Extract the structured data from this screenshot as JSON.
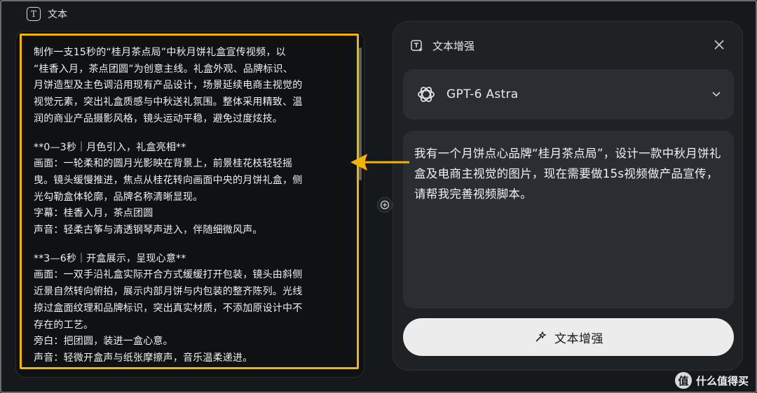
{
  "topbar": {
    "title": "文本",
    "icon": "text-icon"
  },
  "left_panel": {
    "script": {
      "intro": [
        "制作一支15秒的“桂月茶点局”中秋月饼礼盒宣传视频，以",
        "“桂香入月，茶点团圆”为创意主线。礼盒外观、品牌标识、",
        "月饼造型及主色调沿用现有产品设计，场景延续电商主视觉的",
        "视觉元素，突出礼盒质感与中秋送礼氛围。整体采用精致、温",
        "润的商业产品摄影风格，镜头运动平稳，避免过度炫技。"
      ],
      "scene1": [
        "**0—3秒｜月色引入，礼盒亮相**",
        "画面：一轮柔和的圆月光影映在背景上，前景桂花枝轻轻摇",
        "曳。镜头缓慢推进，焦点从桂花转向画面中央的月饼礼盒，侧",
        "光勾勒盒体轮廓，品牌名称清晰显现。",
        "字幕：桂香入月，茶点团圆",
        "声音：轻柔古筝与清透钢琴声进入，伴随细微风声。"
      ],
      "scene2": [
        "**3—6秒｜开盒展示，呈现心意**",
        "画面：一双手沿礼盒实际开合方式缓缓打开包装，镜头由斜侧",
        "近景自然转向俯拍，展示内部月饼与内包装的整齐陈列。光线",
        "掠过盒面纹理和品牌标识，突出真实材质，不添加原设计中不",
        "存在的工艺。",
        "旁白：把团圆，装进一盒心意。",
        "声音：轻微开盒声与纸张摩擦声，音乐温柔递进。"
      ]
    }
  },
  "right_panel": {
    "title": "文本增强",
    "title_icon": "text-enhance-icon",
    "close_icon": "close-icon",
    "model": {
      "name": "GPT-6 Astra",
      "icon": "openai-logo-icon",
      "chevron": "chevron-down-icon"
    },
    "prompt": "我有一个月饼点心品牌“桂月茶点局”，设计一款中秋月饼礼盒及电商主视觉的图片，现在需要做15s视频做产品宣传，请帮我完善视频脚本。",
    "button": {
      "label": "文本增强",
      "icon": "sparkle-wand-icon"
    }
  },
  "watermark": {
    "badge": "值",
    "text": "什么值得买"
  },
  "colors": {
    "highlight": "#f4b400",
    "arrow": "#f4b400",
    "bg": "#16191c",
    "card": "#1f2225",
    "button": "#ececec"
  }
}
